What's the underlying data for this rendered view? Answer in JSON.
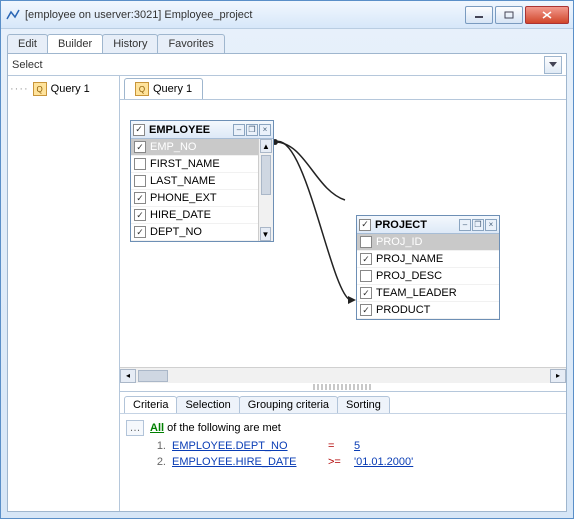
{
  "window": {
    "title": "[employee on userver:3021] Employee_project"
  },
  "outer_tabs": [
    "Edit",
    "Builder",
    "History",
    "Favorites"
  ],
  "outer_tabs_active": 1,
  "select_label": "Select",
  "tree": {
    "items": [
      {
        "label": "Query 1"
      }
    ]
  },
  "query_tab": "Query 1",
  "tables": {
    "employee": {
      "name": "EMPLOYEE",
      "head_checked": true,
      "cols": [
        {
          "name": "EMP_NO",
          "checked": true,
          "selected": true
        },
        {
          "name": "FIRST_NAME",
          "checked": false
        },
        {
          "name": "LAST_NAME",
          "checked": false
        },
        {
          "name": "PHONE_EXT",
          "checked": true
        },
        {
          "name": "HIRE_DATE",
          "checked": true
        },
        {
          "name": "DEPT_NO",
          "checked": true
        }
      ]
    },
    "project": {
      "name": "PROJECT",
      "head_checked": true,
      "cols": [
        {
          "name": "PROJ_ID",
          "checked": false,
          "selected": true
        },
        {
          "name": "PROJ_NAME",
          "checked": true
        },
        {
          "name": "PROJ_DESC",
          "checked": false
        },
        {
          "name": "TEAM_LEADER",
          "checked": true
        },
        {
          "name": "PRODUCT",
          "checked": true
        }
      ]
    }
  },
  "bottom_tabs": [
    "Criteria",
    "Selection",
    "Grouping criteria",
    "Sorting"
  ],
  "bottom_tabs_active": 0,
  "criteria": {
    "mode": "All",
    "mode_suffix": " of the following are met",
    "rows": [
      {
        "n": "1.",
        "field": "EMPLOYEE.DEPT_NO",
        "op": "=",
        "val": "5"
      },
      {
        "n": "2.",
        "field": "EMPLOYEE.HIRE_DATE",
        "op": ">=",
        "val": "'01.01.2000'"
      }
    ]
  }
}
